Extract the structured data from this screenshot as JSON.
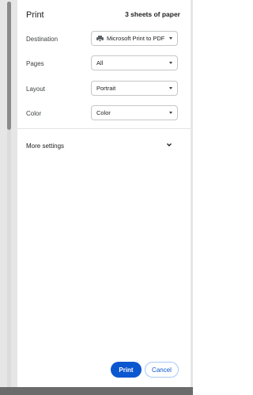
{
  "header": {
    "title": "Print",
    "sheets": "3 sheets of paper"
  },
  "settings": [
    {
      "label": "Destination",
      "value": "Microsoft Print to PDF",
      "icon": "printer-icon"
    },
    {
      "label": "Pages",
      "value": "All"
    },
    {
      "label": "Layout",
      "value": "Portrait"
    },
    {
      "label": "Color",
      "value": "Color"
    }
  ],
  "more_settings": {
    "label": "More settings",
    "icon": "chevron-down-icon"
  },
  "actions": {
    "print_label": "Print",
    "cancel_label": "Cancel"
  },
  "colors": {
    "primary": "#0b57d0",
    "border": "#c4c7c5",
    "gutter": "#e6e6e6",
    "bottom_bar": "#6b6b6b"
  }
}
